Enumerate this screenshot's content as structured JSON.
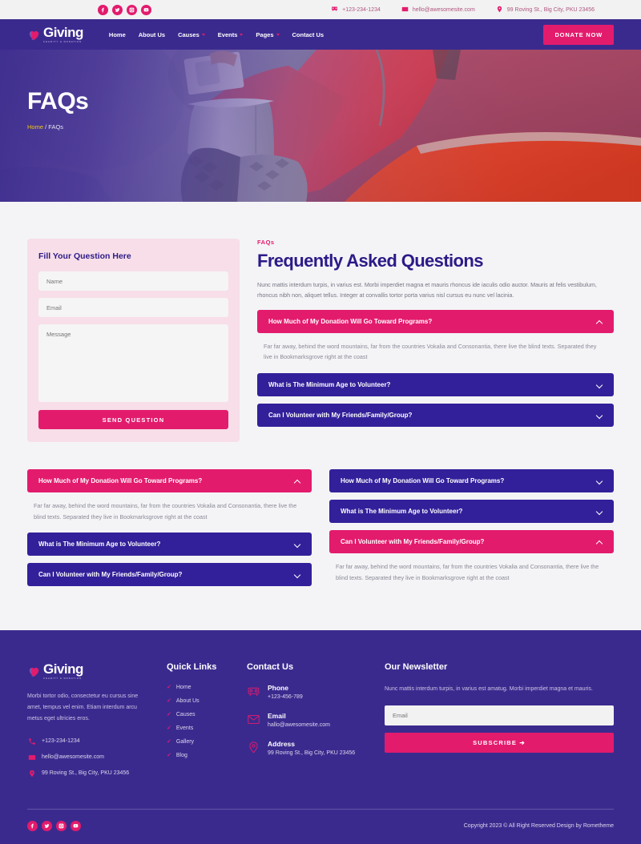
{
  "topbar": {
    "social": [
      {
        "name": "facebook-icon",
        "glyph": "f"
      },
      {
        "name": "twitter-icon",
        "glyph": "t"
      },
      {
        "name": "instagram-icon",
        "glyph": "i"
      },
      {
        "name": "youtube-icon",
        "glyph": "y"
      }
    ],
    "phone": "+123-234-1234",
    "email": "hello@awesomesite.com",
    "address": "99 Roving St., Big City, PKU 23456"
  },
  "header": {
    "brand": "Giving",
    "brand_tagline": "CHARITY & DONATION",
    "nav": [
      {
        "label": "Home",
        "caret": false
      },
      {
        "label": "About Us",
        "caret": false
      },
      {
        "label": "Causes",
        "caret": true
      },
      {
        "label": "Events",
        "caret": true
      },
      {
        "label": "Pages",
        "caret": true
      },
      {
        "label": "Contact Us",
        "caret": false
      }
    ],
    "donate_label": "DONATE NOW"
  },
  "hero": {
    "title": "FAQs",
    "crumb_home": "Home",
    "crumb_sep": "/",
    "crumb_current": "FAQs"
  },
  "form": {
    "title": "Fill Your Question Here",
    "name_placeholder": "Name",
    "email_placeholder": "Email",
    "message_placeholder": "Message",
    "submit_label": "SEND QUESTION"
  },
  "faq": {
    "kicker": "FAQs",
    "heading": "Frequently Asked Questions",
    "intro": "Nunc mattis interdum turpis, in varius est. Morbi imperdiet magna et mauris rhoncus ide iaculis odio auctor. Mauris at felis vestibulum, rhoncus nibh non, aliquet tellus. Integer at convallis tortor porta varius nisl cursus eu nunc vel lacinia.",
    "answer": "Far far away, behind the word mountains, far from the countries Vokalia and Consonantia, there live the blind texts. Separated they live in Bookmarksgrove right at the coast",
    "q1": "How Much of My Donation Will Go Toward Programs?",
    "q2": "What is The Minimum Age to Volunteer?",
    "q3": "Can I Volunteer with My Friends/Family/Group?"
  },
  "footer": {
    "brand": "Giving",
    "brand_tagline": "CHARITY & DONATION",
    "desc": "Morbi tortor odio, consectetur eu cursus sine amet, tempus vel enim. Etiam interdum arcu metus eget ultricies eros.",
    "phone": "+123-234-1234",
    "email": "hello@awesomesite.com",
    "address": "99 Roving St., Big City, PKU 23456",
    "quick_links_title": "Quick Links",
    "quick_links": [
      "Home",
      "About Us",
      "Causes",
      "Events",
      "Gallery",
      "Blog"
    ],
    "contact_title": "Contact Us",
    "contact": [
      {
        "icon": "phone-icon",
        "label": "Phone",
        "value": "+123-456-789"
      },
      {
        "icon": "envelope-icon",
        "label": "Email",
        "value": "hallo@awesomesite.com"
      },
      {
        "icon": "location-pin-icon",
        "label": "Address",
        "value": "99 Roving St., Big City, PKU 23456"
      }
    ],
    "newsletter_title": "Our Newsletter",
    "newsletter_desc": "Nunc mattis interdum turpis, in varius est amatug. Morbi imperdiet magna et mauris.",
    "newsletter_placeholder": "Email",
    "subscribe_label": "SUBSCRIBE",
    "copyright": "Copyright 2023 © All Right Reserved Design by Rometheme"
  },
  "colors": {
    "accent_pink": "#e31b6d",
    "brand_purple": "#3b2a8e",
    "deep_purple": "#32209a"
  }
}
